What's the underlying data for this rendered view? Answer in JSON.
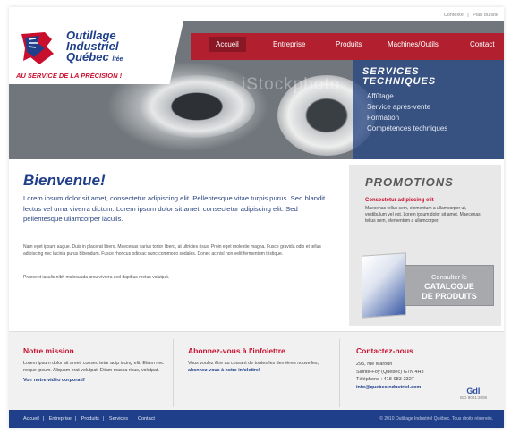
{
  "top_links": [
    "Contexte",
    "Plan du site"
  ],
  "logo": {
    "line1": "Outillage",
    "line2": "Industriel",
    "line3": "Québec",
    "suffix": "ltée",
    "tagline": "AU SERVICE DE LA PRÉCISION !"
  },
  "nav": [
    {
      "label": "Accueil",
      "active": true
    },
    {
      "label": "Entreprise",
      "active": false
    },
    {
      "label": "Produits",
      "active": false
    },
    {
      "label": "Machines/Outils",
      "active": false
    },
    {
      "label": "Contact",
      "active": false
    }
  ],
  "hero": {
    "watermark": "iStockphoto"
  },
  "services": {
    "title_line1": "SERVICES",
    "title_line2": "TECHNIQUES",
    "items": [
      "Affûtage",
      "Service après-vente",
      "Formation",
      "Compétences techniques"
    ]
  },
  "welcome": {
    "title": "Bienvenue!",
    "lead": "Lorem ipsum dolor sit amet, consectetur adipiscing elit. Pellentesque vitae turpis purus. Sed blandit lectus vel urna viverra dictum. Lorem ipsum dolor sit amet, consectetur adipiscing elit. Sed pellentesque ullamcorper iaculis.",
    "para1": "Nam eget ipsum augue. Duis in placerat libero. Maecenas varius tortor libero, at ultricies risus. Proin eget molestie magna. Fusce gravida odio et tellus adipiscing nec lacinia purus bibendum. Fusce rhoncus odio ac nunc commodo sodales. Donec ac nisl non velit fermentum tristique.",
    "para2": "Praesent iaculis nibh malesuada arcu viverra sed dapibus metus volutpat."
  },
  "promo": {
    "title": "PROMOTIONS",
    "subtitle": "Consectetur adipiscing elit",
    "text": "Maecenas tellus sem, elementum a ullamcorper ut, vestibulum vel est. Lorem ipsum dolor sit amet. Maecenas tellus sem, elementum a ullamcorper.",
    "catalog_line1": "Consulter le",
    "catalog_line2": "CATALOGUE",
    "catalog_line3": "DE PRODUITS"
  },
  "boxes": {
    "mission": {
      "title": "Notre mission",
      "text": "Lorem ipsum dolor sit amet, consec tetur adip iscing elit. Etiam nec neque ipsum. Aliquam erat volutpat. Etiam massa risus, volutpat.",
      "link": "Voir notre vidéo corporatif"
    },
    "newsletter": {
      "title": "Abonnez-vous à l'infolettre",
      "text_start": "Vous voulez être au courant de toutes les dernières nouvelles,",
      "link": "abonnez-vous à notre infolettre!"
    },
    "contact": {
      "title": "Contactez-nous",
      "address1": "295, rue Maroun",
      "address2": "Sainte-Foy (Québec) G7N 4H3",
      "phone": "Téléphone : 418-983-2327",
      "email": "info@quebecindustriel.com",
      "cert_logo": "GdI",
      "cert": "ISO 9001:2008"
    }
  },
  "footer": {
    "links": [
      "Accueil",
      "Entreprise",
      "Produits",
      "Services",
      "Contact"
    ],
    "copyright": "© 2010 Outillage Industriel Québec. Tous droits réservés."
  },
  "colors": {
    "brand_red": "#b2202f",
    "brand_blue": "#1f3f8a"
  }
}
